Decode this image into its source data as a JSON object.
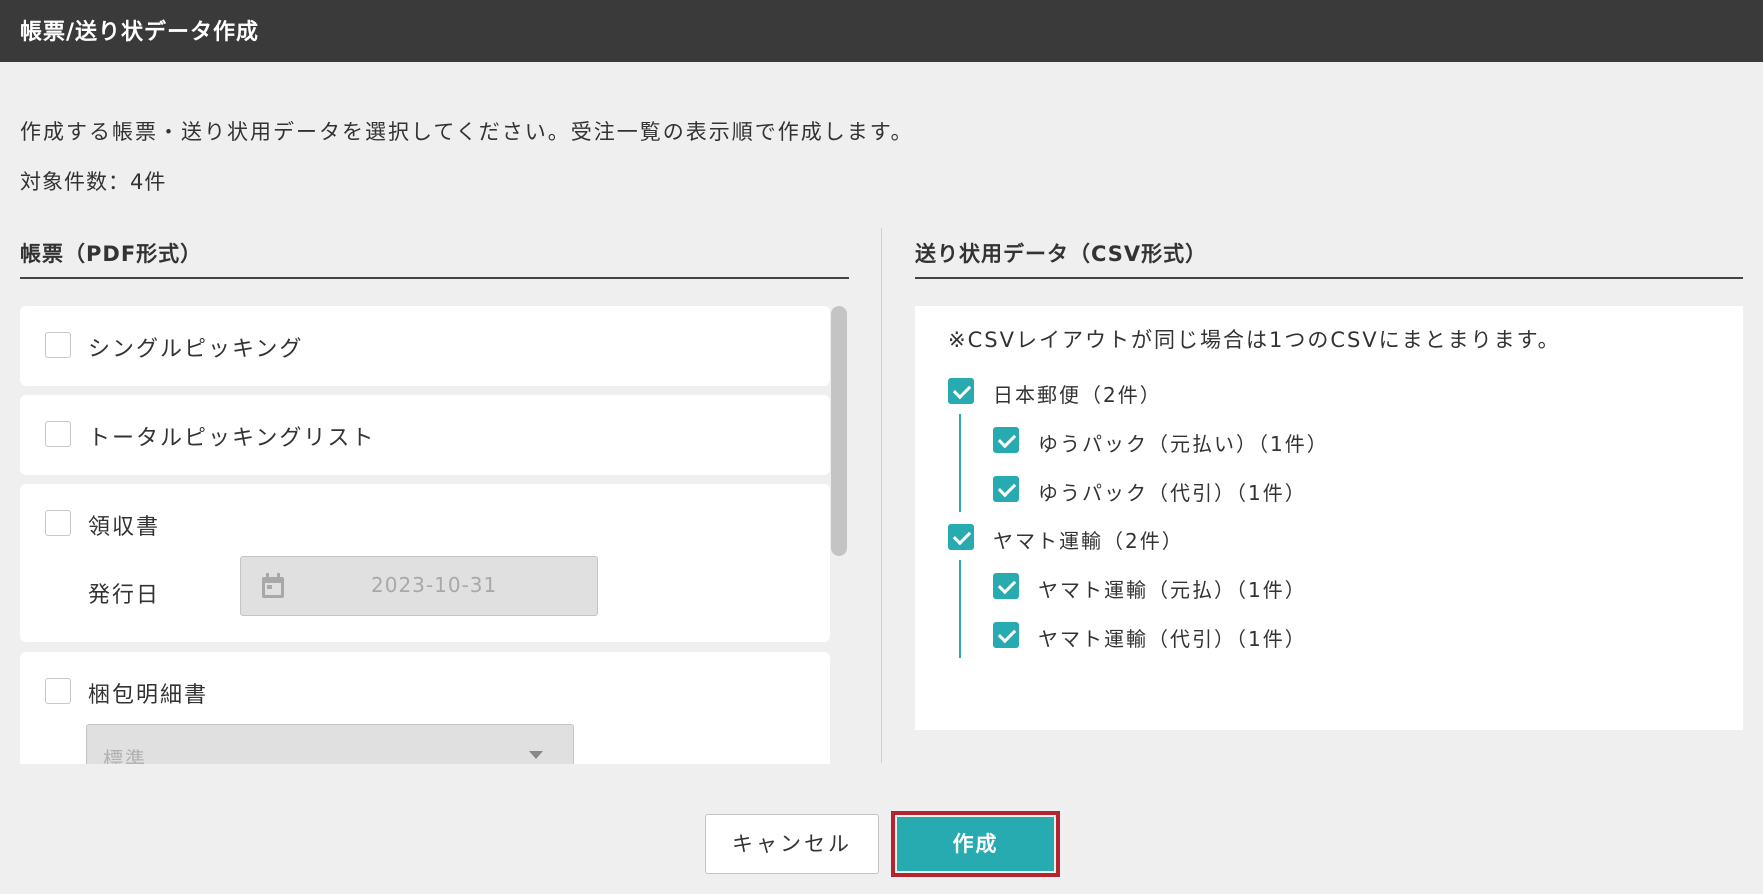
{
  "window": {
    "title": "帳票/送り状データ作成"
  },
  "description": "作成する帳票・送り状用データを選択してください。受注一覧の表示順で作成します。",
  "count_text": "対象件数：4件",
  "pdf_section": {
    "title": "帳票（PDF形式）",
    "items": [
      {
        "label": "シングルピッキング",
        "checked": false
      },
      {
        "label": "トータルピッキングリスト",
        "checked": false
      },
      {
        "label": "領収書",
        "checked": false,
        "issue_date_label": "発行日",
        "issue_date_value": "2023-10-31"
      },
      {
        "label": "梱包明細書",
        "checked": false,
        "select_value": "標準"
      }
    ]
  },
  "csv_section": {
    "title": "送り状用データ（CSV形式）",
    "note": "※CSVレイアウトが同じ場合は1つのCSVにまとまります。",
    "groups": [
      {
        "label": "日本郵便（2件）",
        "checked": true,
        "children": [
          {
            "label": "ゆうパック（元払い）（1件）",
            "checked": true
          },
          {
            "label": "ゆうパック（代引）（1件）",
            "checked": true
          }
        ]
      },
      {
        "label": "ヤマト運輸（2件）",
        "checked": true,
        "children": [
          {
            "label": "ヤマト運輸（元払）（1件）",
            "checked": true
          },
          {
            "label": "ヤマト運輸（代引）（1件）",
            "checked": true
          }
        ]
      }
    ]
  },
  "buttons": {
    "cancel": "キャンセル",
    "create": "作成"
  },
  "colors": {
    "accent": "#27aab0",
    "titlebar": "#3a3a3a",
    "highlight": "#b3262f"
  }
}
